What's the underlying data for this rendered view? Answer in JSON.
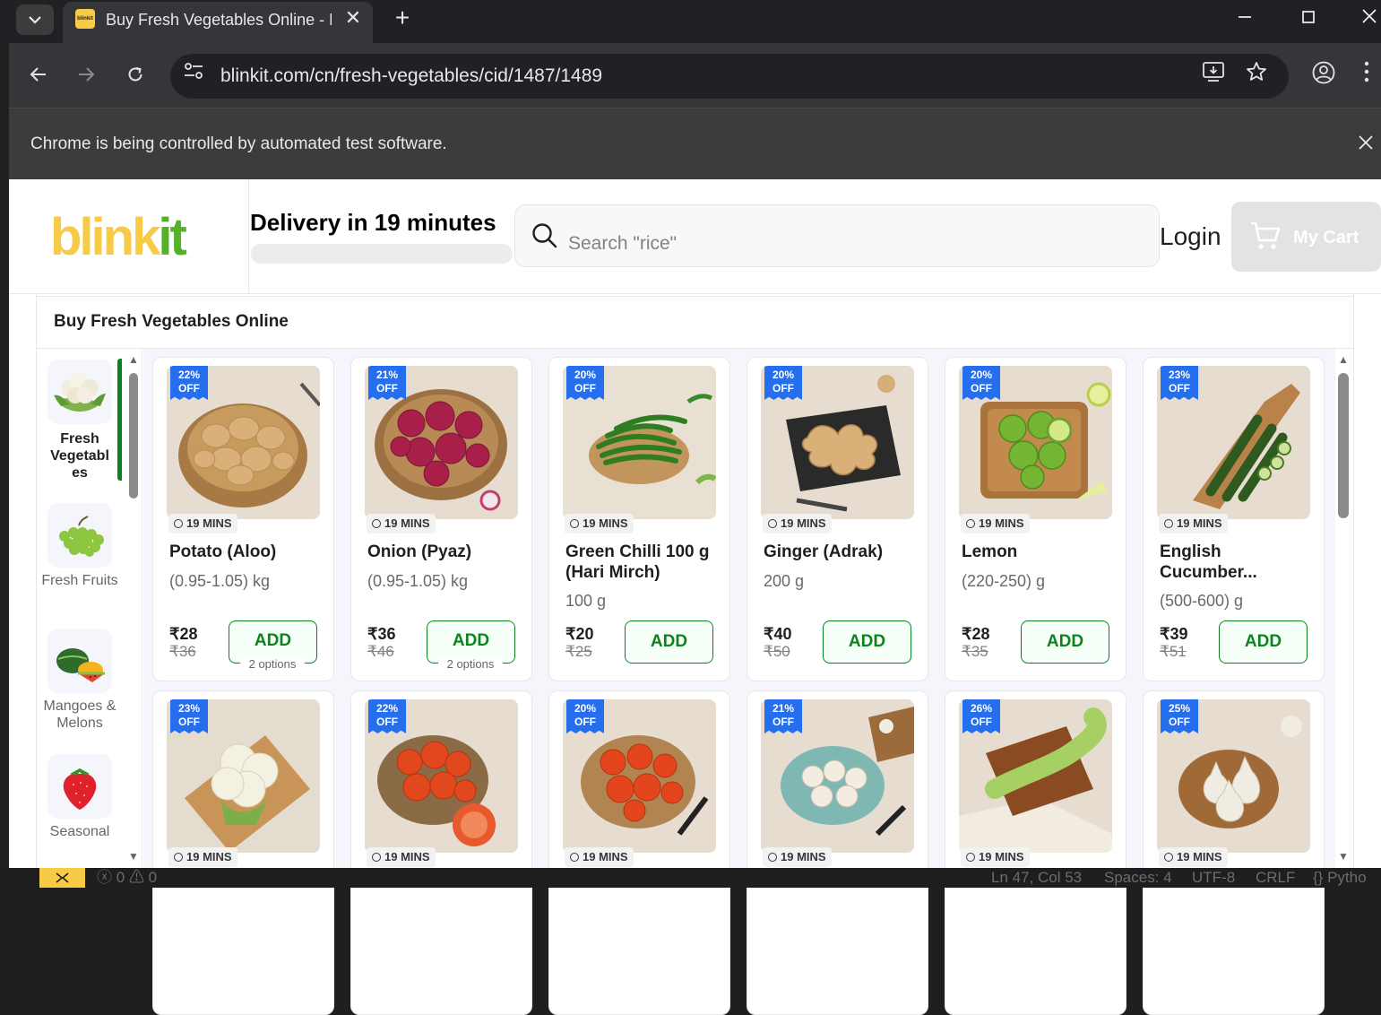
{
  "browser": {
    "tab_title": "Buy Fresh Vegetables Online - P",
    "favicon_text": "blinkit",
    "url": "blinkit.com/cn/fresh-vegetables/cid/1487/1489",
    "infobar_text": "Chrome is being controlled by automated test software."
  },
  "header": {
    "logo_part1": "blink",
    "logo_part2": "it",
    "delivery": "Delivery in 19 minutes",
    "search_placeholder": "Search \"rice\"",
    "login": "Login",
    "cart": "My Cart"
  },
  "page_title": "Buy Fresh Vegetables Online",
  "categories": [
    {
      "label": "Fresh Vegetabl es",
      "icon": "cauliflower-icon"
    },
    {
      "label": "Fresh Fruits",
      "icon": "grapes-icon"
    },
    {
      "label": "Mangoes & Melons",
      "icon": "watermelon-icon"
    },
    {
      "label": "Seasonal",
      "icon": "strawberry-icon"
    }
  ],
  "products": [
    {
      "name": "Potato (Aloo)",
      "qty": "(0.95-1.05) kg",
      "price": "₹28",
      "mrp": "₹36",
      "off_pct": "22%",
      "off_word": "OFF",
      "eta": "19 MINS",
      "add": "ADD",
      "options": "2 options"
    },
    {
      "name": "Onion (Pyaz)",
      "qty": "(0.95-1.05) kg",
      "price": "₹36",
      "mrp": "₹46",
      "off_pct": "21%",
      "off_word": "OFF",
      "eta": "19 MINS",
      "add": "ADD",
      "options": "2 options"
    },
    {
      "name": "Green Chilli 100 g (Hari Mirch)",
      "qty": "100 g",
      "price": "₹20",
      "mrp": "₹25",
      "off_pct": "20%",
      "off_word": "OFF",
      "eta": "19 MINS",
      "add": "ADD"
    },
    {
      "name": "Ginger (Adrak)",
      "qty": "200 g",
      "price": "₹40",
      "mrp": "₹50",
      "off_pct": "20%",
      "off_word": "OFF",
      "eta": "19 MINS",
      "add": "ADD"
    },
    {
      "name": "Lemon",
      "qty": "(220-250) g",
      "price": "₹28",
      "mrp": "₹35",
      "off_pct": "20%",
      "off_word": "OFF",
      "eta": "19 MINS",
      "add": "ADD"
    },
    {
      "name": "English Cucumber...",
      "qty": "(500-600) g",
      "price": "₹39",
      "mrp": "₹51",
      "off_pct": "23%",
      "off_word": "OFF",
      "eta": "19 MINS",
      "add": "ADD"
    },
    {
      "off_pct": "23%",
      "off_word": "OFF",
      "eta": "19 MINS"
    },
    {
      "off_pct": "22%",
      "off_word": "OFF",
      "eta": "19 MINS"
    },
    {
      "off_pct": "20%",
      "off_word": "OFF",
      "eta": "19 MINS"
    },
    {
      "off_pct": "21%",
      "off_word": "OFF",
      "eta": "19 MINS"
    },
    {
      "off_pct": "26%",
      "off_word": "OFF",
      "eta": "19 MINS"
    },
    {
      "off_pct": "25%",
      "off_word": "OFF",
      "eta": "19 MINS"
    }
  ],
  "statusbar": {
    "errors": "0",
    "warnings": "0",
    "position": "Ln 47, Col 53",
    "spaces": "Spaces: 4",
    "encoding": "UTF-8",
    "eol": "CRLF",
    "language": "{} Pytho"
  },
  "colors": {
    "brand_yellow": "#f8cb46",
    "brand_green": "#54b226",
    "add_green": "#0c831f",
    "badge_blue": "#256fef"
  }
}
